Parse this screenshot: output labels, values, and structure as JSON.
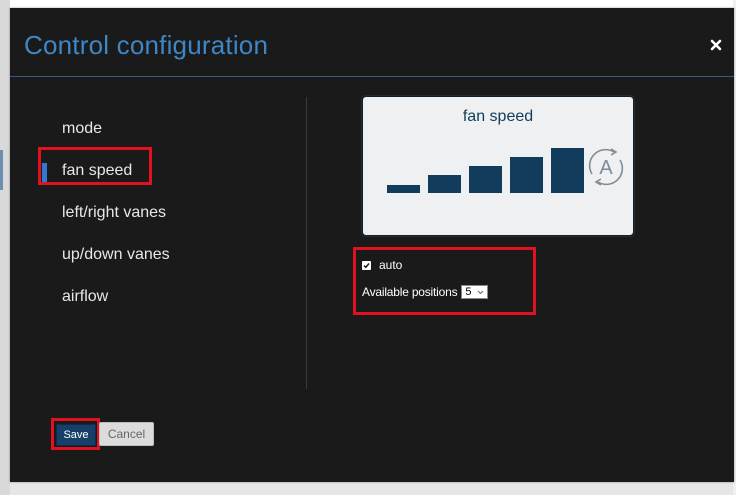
{
  "dialog": {
    "title": "Control configuration",
    "close_icon": "close-icon"
  },
  "menu": {
    "items": [
      {
        "label": "mode",
        "active": false
      },
      {
        "label": "fan speed",
        "active": true
      },
      {
        "label": "left/right vanes",
        "active": false
      },
      {
        "label": "up/down vanes",
        "active": false
      },
      {
        "label": "airflow",
        "active": false
      }
    ]
  },
  "preview": {
    "title": "fan speed",
    "levels": 5,
    "auto_icon_letter": "A",
    "bar_color": "#123c5c"
  },
  "options": {
    "auto_label": "auto",
    "auto_checked": true,
    "positions_label": "Available positions",
    "positions_value": "5"
  },
  "footer": {
    "save_label": "Save",
    "cancel_label": "Cancel"
  },
  "colors": {
    "accent": "#3f86c6",
    "highlight": "#e0121f",
    "active_marker": "#2f7ad1"
  }
}
